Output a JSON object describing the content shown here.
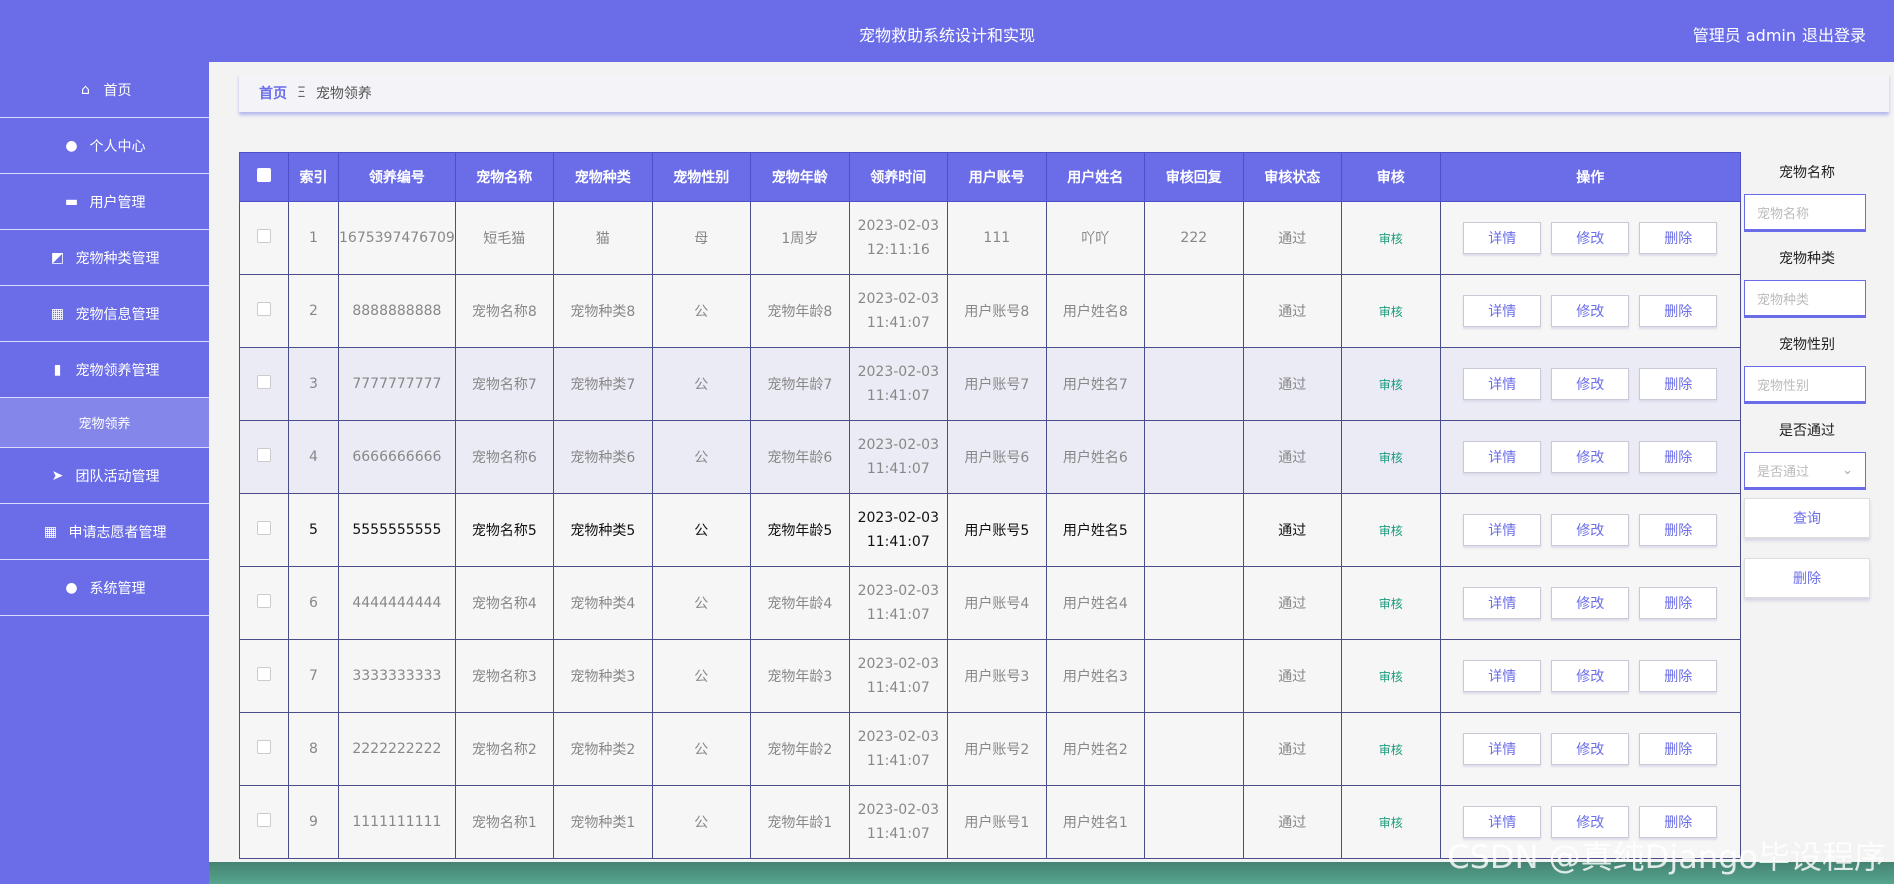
{
  "header": {
    "title": "宠物救助系统设计和实现",
    "user": "管理员 admin",
    "logout": "退出登录"
  },
  "sidebar": {
    "items": [
      {
        "label": "首页",
        "icon": "home-icon"
      },
      {
        "label": "个人中心",
        "icon": "user-icon"
      },
      {
        "label": "用户管理",
        "icon": "monitor-icon"
      },
      {
        "label": "宠物种类管理",
        "icon": "chart-line-icon"
      },
      {
        "label": "宠物信息管理",
        "icon": "grid-icon"
      },
      {
        "label": "宠物领养管理",
        "icon": "bar-chart-icon"
      },
      {
        "label": "宠物领养",
        "sub": true
      },
      {
        "label": "团队活动管理",
        "icon": "send-icon"
      },
      {
        "label": "申请志愿者管理",
        "icon": "grid-icon"
      },
      {
        "label": "系统管理",
        "icon": "bulb-icon"
      }
    ]
  },
  "breadcrumb": {
    "home": "首页",
    "sep": "Ξ",
    "current": "宠物领养"
  },
  "table": {
    "headers": [
      "索引",
      "领养编号",
      "宠物名称",
      "宠物种类",
      "宠物性别",
      "宠物年龄",
      "领养时间",
      "用户账号",
      "用户姓名",
      "审核回复",
      "审核状态",
      "审核",
      "操作"
    ],
    "rows": [
      {
        "idx": "1",
        "no": "1675397476709",
        "name": "短毛猫",
        "kind": "猫",
        "sex": "母",
        "age": "1周岁",
        "time": "2023-02-03 12:11:16",
        "acct": "111",
        "uname": "吖吖",
        "reply": "222",
        "status": "通过",
        "audit": "审核"
      },
      {
        "idx": "2",
        "no": "8888888888",
        "name": "宠物名称8",
        "kind": "宠物种类8",
        "sex": "公",
        "age": "宠物年龄8",
        "time": "2023-02-03 11:41:07",
        "acct": "用户账号8",
        "uname": "用户姓名8",
        "reply": "",
        "status": "通过",
        "audit": "审核"
      },
      {
        "idx": "3",
        "no": "7777777777",
        "name": "宠物名称7",
        "kind": "宠物种类7",
        "sex": "公",
        "age": "宠物年龄7",
        "time": "2023-02-03 11:41:07",
        "acct": "用户账号7",
        "uname": "用户姓名7",
        "reply": "",
        "status": "通过",
        "audit": "审核"
      },
      {
        "idx": "4",
        "no": "6666666666",
        "name": "宠物名称6",
        "kind": "宠物种类6",
        "sex": "公",
        "age": "宠物年龄6",
        "time": "2023-02-03 11:41:07",
        "acct": "用户账号6",
        "uname": "用户姓名6",
        "reply": "",
        "status": "通过",
        "audit": "审核"
      },
      {
        "idx": "5",
        "no": "5555555555",
        "name": "宠物名称5",
        "kind": "宠物种类5",
        "sex": "公",
        "age": "宠物年龄5",
        "time": "2023-02-03 11:41:07",
        "acct": "用户账号5",
        "uname": "用户姓名5",
        "reply": "",
        "status": "通过",
        "audit": "审核"
      },
      {
        "idx": "6",
        "no": "4444444444",
        "name": "宠物名称4",
        "kind": "宠物种类4",
        "sex": "公",
        "age": "宠物年龄4",
        "time": "2023-02-03 11:41:07",
        "acct": "用户账号4",
        "uname": "用户姓名4",
        "reply": "",
        "status": "通过",
        "audit": "审核"
      },
      {
        "idx": "7",
        "no": "3333333333",
        "name": "宠物名称3",
        "kind": "宠物种类3",
        "sex": "公",
        "age": "宠物年龄3",
        "time": "2023-02-03 11:41:07",
        "acct": "用户账号3",
        "uname": "用户姓名3",
        "reply": "",
        "status": "通过",
        "audit": "审核"
      },
      {
        "idx": "8",
        "no": "2222222222",
        "name": "宠物名称2",
        "kind": "宠物种类2",
        "sex": "公",
        "age": "宠物年龄2",
        "time": "2023-02-03 11:41:07",
        "acct": "用户账号2",
        "uname": "用户姓名2",
        "reply": "",
        "status": "通过",
        "audit": "审核"
      },
      {
        "idx": "9",
        "no": "1111111111",
        "name": "宠物名称1",
        "kind": "宠物种类1",
        "sex": "公",
        "age": "宠物年龄1",
        "time": "2023-02-03 11:41:07",
        "acct": "用户账号1",
        "uname": "用户姓名1",
        "reply": "",
        "status": "通过",
        "audit": "审核"
      }
    ],
    "ops": {
      "detail": "详情",
      "edit": "修改",
      "delete": "删除"
    }
  },
  "filter": {
    "name_label": "宠物名称",
    "name_ph": "宠物名称",
    "kind_label": "宠物种类",
    "kind_ph": "宠物种类",
    "sex_label": "宠物性别",
    "sex_ph": "宠物性别",
    "pass_label": "是否通过",
    "pass_ph": "是否通过",
    "query": "查询",
    "delete": "删除"
  },
  "watermark": "CSDN @真纯Django毕设程序",
  "colors": {
    "accent": "#6b6de8",
    "audit": "#1a9b7b"
  }
}
